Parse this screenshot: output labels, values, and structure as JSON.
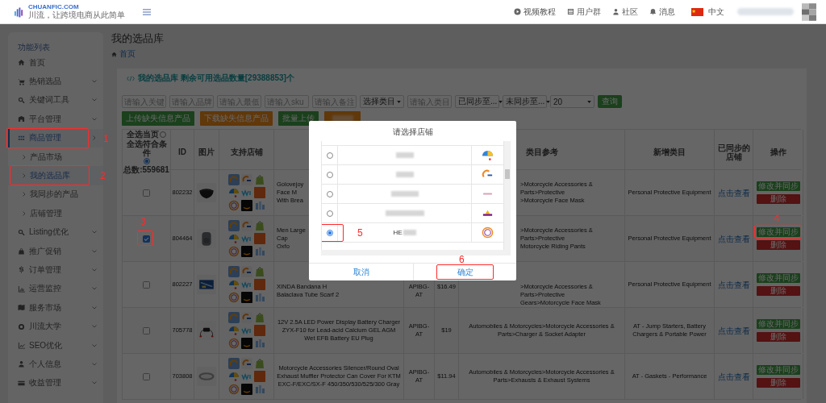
{
  "header": {
    "brand": "CHUANFIC.COM",
    "slogan": "川流，让跨境电商从此简单",
    "links": [
      {
        "label": "视频教程"
      },
      {
        "label": "用户群"
      },
      {
        "label": "社区"
      },
      {
        "label": "消息"
      }
    ],
    "language": "中文"
  },
  "sidebar": {
    "heading": "功能列表",
    "items": [
      {
        "label": "首页",
        "expandable": false,
        "selected": false
      },
      {
        "label": "热销选品",
        "expandable": true,
        "selected": false
      },
      {
        "label": "关键词工具",
        "expandable": true,
        "selected": false
      },
      {
        "label": "平台管理",
        "expandable": true,
        "selected": false
      },
      {
        "label": "商品管理",
        "expandable": true,
        "selected": true,
        "expanded": true,
        "callout": "1",
        "children": [
          {
            "label": "产品市场",
            "selected": false
          },
          {
            "label": "我的选品库",
            "selected": true,
            "callout": "2"
          },
          {
            "label": "我同步的产品",
            "selected": false
          },
          {
            "label": "店铺管理",
            "selected": false
          }
        ]
      },
      {
        "label": "Listing优化",
        "expandable": true,
        "selected": false
      },
      {
        "label": "推广促销",
        "expandable": true,
        "selected": false
      },
      {
        "label": "订单管理",
        "expandable": true,
        "selected": false
      },
      {
        "label": "运营监控",
        "expandable": true,
        "selected": false
      },
      {
        "label": "服务市场",
        "expandable": true,
        "selected": false
      },
      {
        "label": "川流大学",
        "expandable": true,
        "selected": false
      },
      {
        "label": "SEO优化",
        "expandable": true,
        "selected": false
      },
      {
        "label": "个人信息",
        "expandable": true,
        "selected": false
      },
      {
        "label": "收益管理",
        "expandable": true,
        "selected": false
      }
    ]
  },
  "page": {
    "title": "我的选品库",
    "breadcrumb": "首页",
    "card_title": "我的选品库 剩余可用选品数量[29388853]个"
  },
  "filters": [
    {
      "kind": "input",
      "placeholder": "请输入关键"
    },
    {
      "kind": "input",
      "placeholder": "请输入品牌"
    },
    {
      "kind": "input",
      "placeholder": "请输入最低"
    },
    {
      "kind": "input",
      "placeholder": "请输入sku"
    },
    {
      "kind": "input",
      "placeholder": "请输入备注"
    },
    {
      "kind": "select",
      "value": "选择类目"
    },
    {
      "kind": "input",
      "placeholder": "请输入类目"
    },
    {
      "kind": "select",
      "value": "已同步至..."
    },
    {
      "kind": "select",
      "value": "未同步至..."
    },
    {
      "kind": "select",
      "value": "20"
    }
  ],
  "query_button": "查询",
  "actions": [
    {
      "kind": "green",
      "label": "上传缺失信息产品"
    },
    {
      "kind": "orange",
      "label": "下载缺失信息产品"
    },
    {
      "kind": "green",
      "label": "批量上传"
    },
    {
      "kind": "orange"
    }
  ],
  "table": {
    "select_header": {
      "page_label": "全选当页",
      "page_selected": false,
      "all_label": "全选符合条件",
      "all_selected": true,
      "total": "总数:559681"
    },
    "columns": [
      "ID",
      "图片",
      "支持店铺",
      "类目参考",
      "新增类目",
      "已同步的店铺",
      "操作"
    ],
    "rows": [
      {
        "checked": false,
        "id": "802232",
        "title": "Golovejoy Face M\nWith Brea",
        "category": ">Motorcycle Accessories & Parts>Protective\n>Motorcycle Face Mask",
        "new_category": "Personal Protective Equipment",
        "synced": "点击查看",
        "edit": "修改并同步",
        "delete": "删除"
      },
      {
        "checked": true,
        "checkbox_callout": "3",
        "id": "804464",
        "title": "Men Large Cap\nOxfo",
        "category": ">Motorcycle Accessories & Parts>Protective\nMotorcycle Riding Pants",
        "new_category": "Personal Protective Equipment",
        "synced": "点击查看",
        "edit": "修改并同步",
        "edit_callout": "4",
        "delete": "删除"
      },
      {
        "checked": false,
        "id": "802227",
        "title": "XINDA Bandana H\nBalaclava Tube Scarf 2",
        "sku": "APIBG-AT",
        "price": "$16.49",
        "category": ">Motorcycle Accessories & Parts>Protective\nGears>Motorcycle Face Mask",
        "new_category": "Personal Protective Equipment",
        "synced": "点击查看",
        "edit": "修改并同步",
        "delete": "删除"
      },
      {
        "checked": false,
        "id": "705778",
        "title": "12V 2.5A LED Power Display Battery Charger ZYX-F10 for Lead-acid Calcium GEL AGM Wet EFB Battery EU Plug",
        "sku": "APIBG-AT",
        "price": "$19",
        "category": "Automobiles & Motorcycles>Motorcycle Accessories & Parts>Charger & Socket Adapter",
        "new_category": "AT - Jump Starters, Battery Chargers & Portable Power",
        "synced": "点击查看",
        "edit": "修改并同步",
        "delete": "删除"
      },
      {
        "checked": false,
        "id": "703808",
        "title": "Motorcycle Accessories Silencer/Round Oval Exhaust Muffler Protector Can Cover For KTM EXC-F/EXC/SX-F 450/350/530/525/300 Gray",
        "sku": "APIBG-AT",
        "price": "$11.94",
        "category": "Automobiles & Motorcycles>Motorcycle Accessories & Parts>Exhausts & Exhaust Systems",
        "new_category": "AT - Gaskets - Performance",
        "synced": "点击查看",
        "edit": "修改并同步",
        "delete": "删除"
      }
    ]
  },
  "modal": {
    "title": "请选择店铺",
    "stores": [
      {
        "selected": false
      },
      {
        "selected": false
      },
      {
        "selected": false
      },
      {
        "selected": false
      },
      {
        "name": "HE",
        "selected": true,
        "callout": "5"
      }
    ],
    "cancel": "取消",
    "confirm": "确定",
    "confirm_callout": "6"
  }
}
